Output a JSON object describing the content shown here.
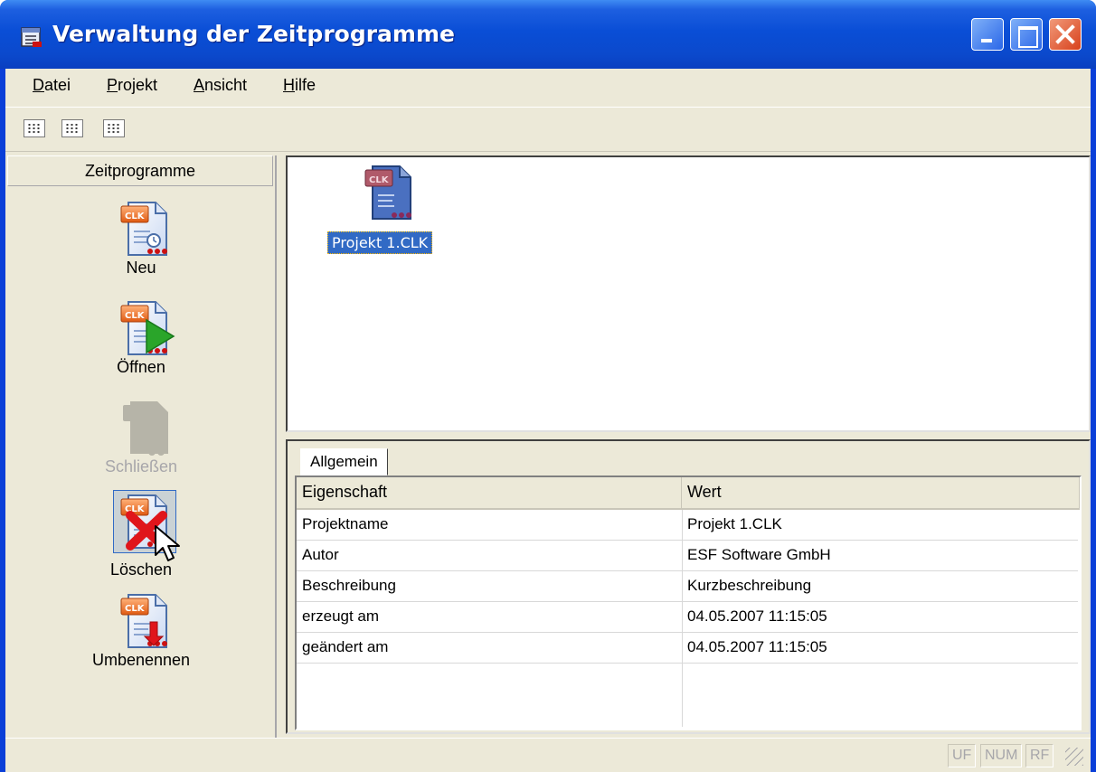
{
  "window": {
    "title": "Verwaltung der Zeitprogramme",
    "title_icon": "window-list-icon",
    "controls": [
      "minimize",
      "maximize",
      "close"
    ]
  },
  "menu": {
    "items": [
      {
        "label": "Datei",
        "hotkey": "D"
      },
      {
        "label": "Projekt",
        "hotkey": "P"
      },
      {
        "label": "Ansicht",
        "hotkey": "A"
      },
      {
        "label": "Hilfe",
        "hotkey": "H"
      }
    ]
  },
  "toolbar": {
    "buttons": [
      "large-icons-view-icon",
      "small-icons-view-icon",
      "details-view-icon"
    ]
  },
  "sidebar": {
    "header": "Zeitprogramme",
    "actions": [
      {
        "label": "Neu",
        "icon": "clk-new-icon",
        "enabled": true
      },
      {
        "label": "Öffnen",
        "icon": "clk-open-icon",
        "enabled": true
      },
      {
        "label": "Schließen",
        "icon": "clk-close-icon",
        "enabled": false
      },
      {
        "label": "Löschen",
        "icon": "clk-delete-icon",
        "enabled": true,
        "hovered": true
      },
      {
        "label": "Umbenennen",
        "icon": "clk-rename-icon",
        "enabled": true
      }
    ]
  },
  "files": [
    {
      "name": "Projekt 1.CLK",
      "icon": "clk-file-icon",
      "selected": true
    }
  ],
  "properties": {
    "tab": "Allgemein",
    "columns": [
      "Eigenschaft",
      "Wert"
    ],
    "rows": [
      [
        "Projektname",
        "Projekt 1.CLK"
      ],
      [
        "Autor",
        "ESF Software GmbH"
      ],
      [
        "Beschreibung",
        "Kurzbeschreibung"
      ],
      [
        "erzeugt am",
        "04.05.2007 11:15:05"
      ],
      [
        "geändert am",
        "04.05.2007 11:15:05"
      ]
    ]
  },
  "statusbar": {
    "indicators": [
      "UF",
      "NUM",
      "RF"
    ]
  },
  "colors": {
    "titlebar": "#0a4ed6",
    "selection": "#316ac5",
    "face": "#ece9d8",
    "delete_red": "#e0151b",
    "open_green": "#2aa52a"
  }
}
